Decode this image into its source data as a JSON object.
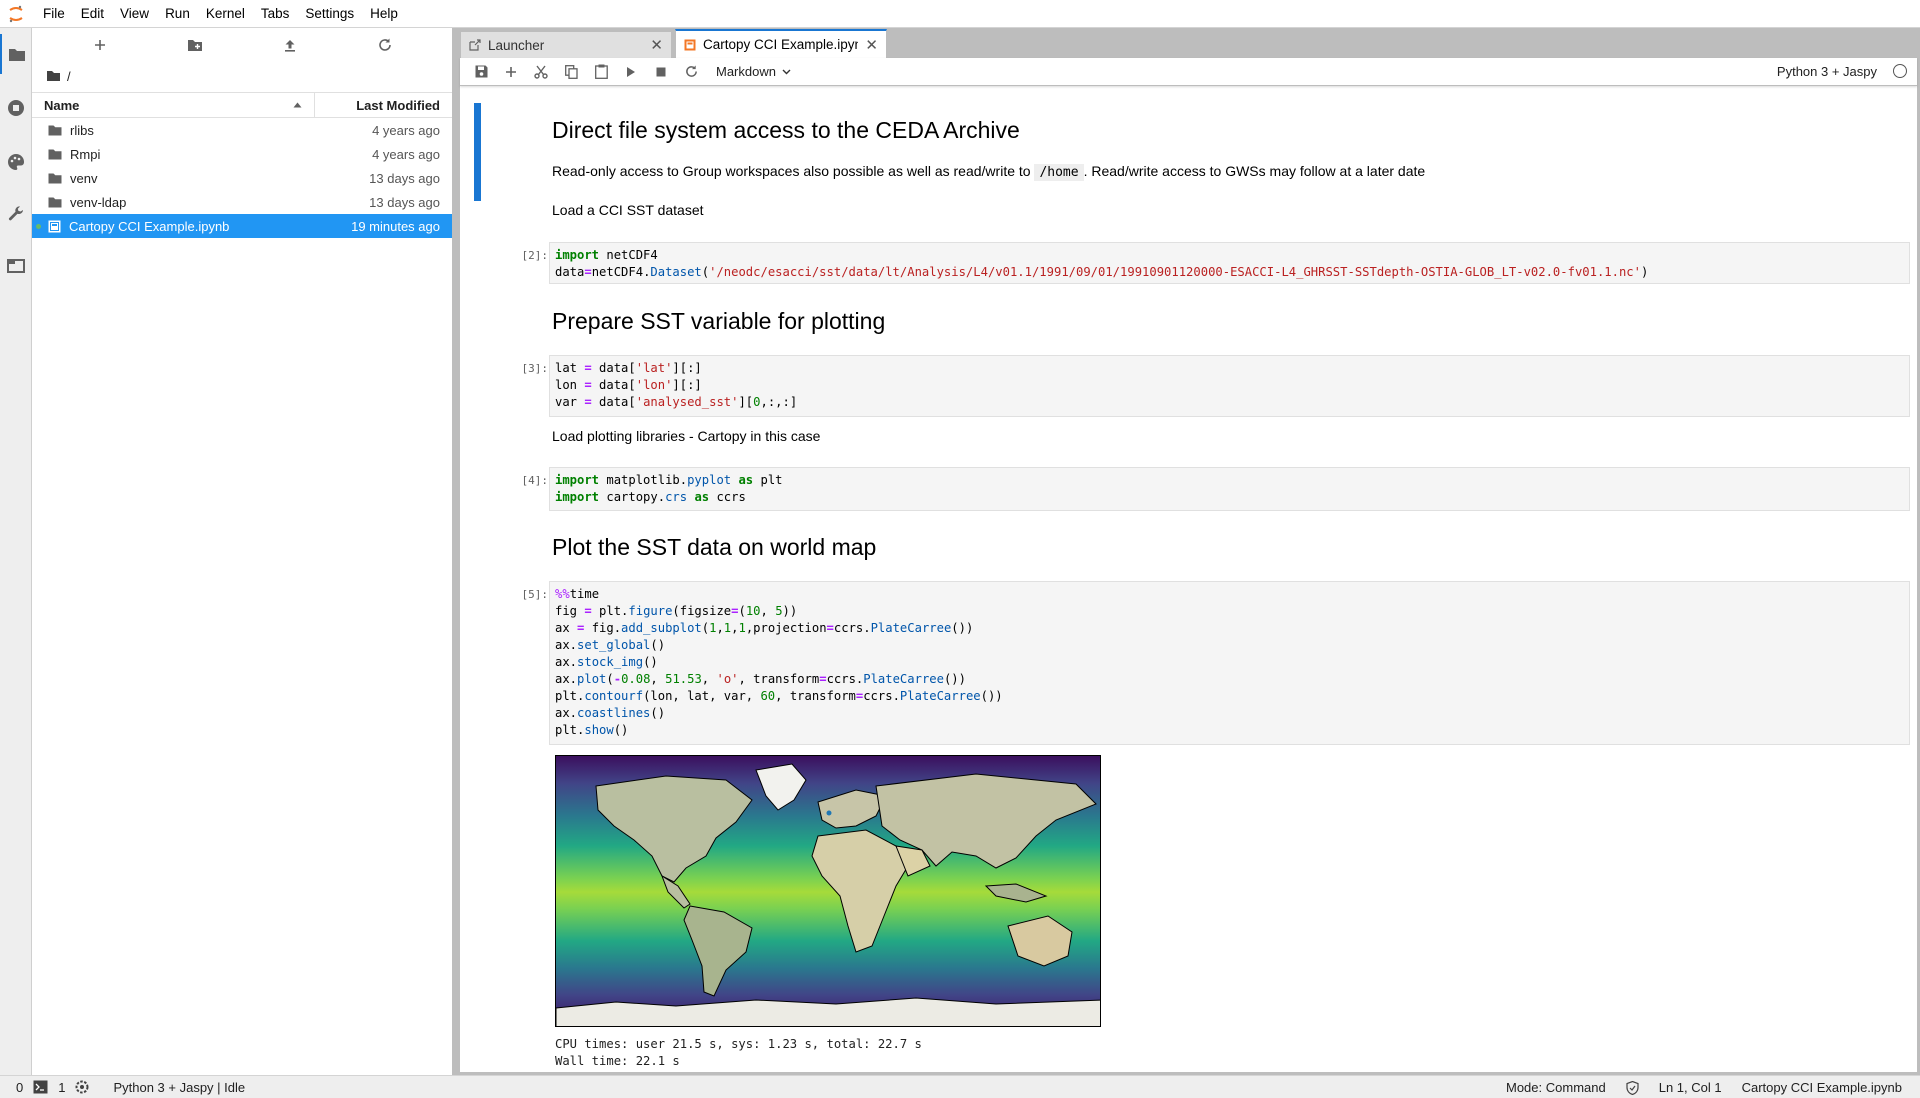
{
  "menubar": {
    "items": [
      "File",
      "Edit",
      "View",
      "Run",
      "Kernel",
      "Tabs",
      "Settings",
      "Help"
    ]
  },
  "filebrowser": {
    "breadcrumb": "/",
    "columns": {
      "name": "Name",
      "modified": "Last Modified"
    },
    "rows": [
      {
        "name": "rlibs",
        "modified": "4 years ago",
        "type": "folder"
      },
      {
        "name": "Rmpi",
        "modified": "4 years ago",
        "type": "folder"
      },
      {
        "name": "venv",
        "modified": "13 days ago",
        "type": "folder"
      },
      {
        "name": "venv-ldap",
        "modified": "13 days ago",
        "type": "folder"
      },
      {
        "name": "Cartopy CCI Example.ipynb",
        "modified": "19 minutes ago",
        "type": "notebook"
      }
    ]
  },
  "tabs": [
    {
      "label": "Launcher"
    },
    {
      "label": "Cartopy CCI Example.ipynb"
    }
  ],
  "notebook": {
    "cell_type": "Markdown",
    "kernel": "Python 3 + Jaspy",
    "md1": {
      "heading": "Direct file system access to the CEDA Archive",
      "p1_before": "Read-only access to Group workspaces also possible as well as read/write to",
      "p1_code": "/home",
      "p1_after": ". Read/write access to GWSs may follow at a later date",
      "p2": "Load a CCI SST dataset"
    },
    "cell2": {
      "prompt": "[2]:",
      "dataset_path": "'/neodc/esacci/sst/data/lt/Analysis/L4/v01.1/1991/09/01/19910901120000-ESACCI-L4_GHRSST-SSTdepth-OSTIA-GLOB_LT-v02.0-fv01.1.nc'"
    },
    "md2": {
      "heading": "Prepare SST variable for plotting"
    },
    "cell3": {
      "prompt": "[3]:"
    },
    "md3": {
      "p": "Load plotting libraries - Cartopy in this case"
    },
    "cell4": {
      "prompt": "[4]:"
    },
    "md4": {
      "heading": "Plot the SST data on world map"
    },
    "cell5": {
      "prompt": "[5]:",
      "output_line1": "CPU times: user 21.5 s, sys: 1.23 s, total: 22.7 s",
      "output_line2": "Wall time: 22.1 s"
    }
  },
  "statusbar": {
    "terminals": "0",
    "kernels": "1",
    "kernel_status": "Python 3 + Jaspy | Idle",
    "mode": "Mode: Command",
    "cursor": "Ln 1, Col 1",
    "filename": "Cartopy CCI Example.ipynb"
  }
}
